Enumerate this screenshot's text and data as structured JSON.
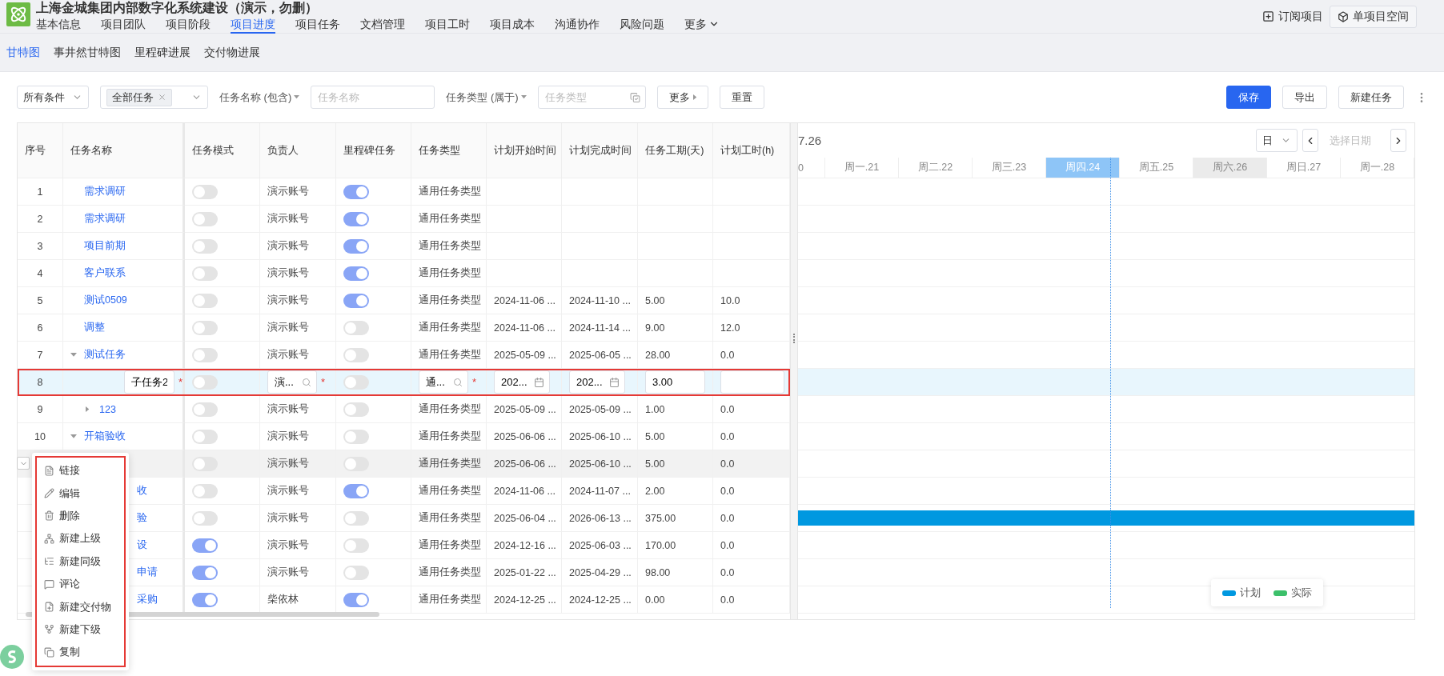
{
  "header": {
    "title": "上海金城集团内部数字化系统建设（演示，勿删）",
    "nav": [
      {
        "label": "基本信息",
        "selected": false
      },
      {
        "label": "项目团队",
        "selected": false
      },
      {
        "label": "项目阶段",
        "selected": false
      },
      {
        "label": "项目进度",
        "selected": true
      },
      {
        "label": "项目任务",
        "selected": false
      },
      {
        "label": "文档管理",
        "selected": false
      },
      {
        "label": "项目工时",
        "selected": false
      },
      {
        "label": "项目成本",
        "selected": false
      },
      {
        "label": "沟通协作",
        "selected": false
      },
      {
        "label": "风险问题",
        "selected": false
      }
    ],
    "more": "更多",
    "subscribe": "订阅项目",
    "space": "单项目空间"
  },
  "subtabs": [
    {
      "label": "甘特图",
      "selected": true
    },
    {
      "label": "事井然甘特图",
      "selected": false
    },
    {
      "label": "里程碑进展",
      "selected": false
    },
    {
      "label": "交付物进展",
      "selected": false
    }
  ],
  "filters": {
    "condition": "所有条件",
    "tag": "全部任务",
    "name_label": "任务名称 (包含)",
    "name_placeholder": "任务名称",
    "type_label": "任务类型 (属于)",
    "type_placeholder": "任务类型",
    "more": "更多",
    "reset": "重置"
  },
  "actions": {
    "save": "保存",
    "export": "导出",
    "new_task": "新建任务"
  },
  "table": {
    "columns": [
      "序号",
      "任务名称",
      "任务模式",
      "负责人",
      "里程碑任务",
      "任务类型",
      "计划开始时间",
      "计划完成时间",
      "任务工期(天)",
      "计划工时(h)"
    ],
    "rows": [
      {
        "kind": "task",
        "no": "1",
        "name": "需求调研",
        "mode": false,
        "milestone": true,
        "owner": "演示账号",
        "type": "通用任务类型"
      },
      {
        "kind": "task",
        "no": "2",
        "name": "需求调研",
        "mode": false,
        "milestone": true,
        "owner": "演示账号",
        "type": "通用任务类型"
      },
      {
        "kind": "task",
        "no": "3",
        "name": "项目前期",
        "mode": false,
        "milestone": true,
        "owner": "演示账号",
        "type": "通用任务类型"
      },
      {
        "kind": "task",
        "no": "4",
        "name": "客户联系",
        "mode": false,
        "milestone": true,
        "owner": "演示账号",
        "type": "通用任务类型"
      },
      {
        "kind": "task",
        "no": "5",
        "name": "测试0509",
        "mode": false,
        "milestone": true,
        "owner": "演示账号",
        "type": "通用任务类型",
        "start": "2024-11-06 ...",
        "end": "2024-11-10 ...",
        "duration": "5.00",
        "hours": "10.0"
      },
      {
        "kind": "task",
        "no": "6",
        "name": "调整",
        "mode": false,
        "milestone": false,
        "owner": "演示账号",
        "type": "通用任务类型",
        "start": "2024-11-06 ...",
        "end": "2024-11-14 ...",
        "duration": "9.00",
        "hours": "12.0"
      },
      {
        "kind": "task",
        "no": "7",
        "name": "测试任务",
        "expanded": true,
        "mode": false,
        "milestone": false,
        "owner": "演示账号",
        "type": "通用任务类型",
        "start": "2025-05-09 ...",
        "end": "2025-06-05 ...",
        "duration": "28.00",
        "hours": "0.0",
        "children": [
          {
            "kind": "edit",
            "no": "8",
            "required_mark": "*",
            "name": "子任务2",
            "mode": false,
            "milestone": false,
            "owner": "演...",
            "type": "通...",
            "start": "202...",
            "end": "202...",
            "duration": "3.00"
          },
          {
            "kind": "task",
            "no": "9",
            "name": "123",
            "expanded": false,
            "mode": false,
            "milestone": false,
            "owner": "演示账号",
            "type": "通用任务类型",
            "start": "2025-05-09 ...",
            "end": "2025-05-09 ...",
            "duration": "1.00",
            "hours": "0.0"
          }
        ]
      },
      {
        "kind": "task",
        "no": "10",
        "name": "开箱验收",
        "expanded": true,
        "mode": false,
        "milestone": false,
        "owner": "演示账号",
        "type": "通用任务类型",
        "start": "2025-06-06 ...",
        "end": "2025-06-10 ...",
        "duration": "5.00",
        "hours": "0.0",
        "children": [
          {
            "kind": "hovered",
            "mode": false,
            "milestone": false,
            "owner": "演示账号",
            "type": "通用任务类型",
            "start": "2025-06-06 ...",
            "end": "2025-06-10 ...",
            "duration": "5.00",
            "hours": "0.0"
          }
        ]
      },
      {
        "kind": "covered",
        "name": "收",
        "mode": false,
        "milestone": true,
        "owner": "演示账号",
        "type": "通用任务类型",
        "start": "2024-11-06 ...",
        "end": "2024-11-07 ...",
        "duration": "2.00",
        "hours": "0.0"
      },
      {
        "kind": "covered",
        "name": "验",
        "mode": false,
        "milestone": false,
        "owner": "演示账号",
        "type": "通用任务类型",
        "start": "2025-06-04 ...",
        "end": "2026-06-13 ...",
        "duration": "375.00",
        "hours": "0.0",
        "plan_bar": true
      },
      {
        "kind": "covered",
        "name": "设",
        "mode": true,
        "milestone": false,
        "owner": "演示账号",
        "type": "通用任务类型",
        "start": "2024-12-16 ...",
        "end": "2025-06-03 ...",
        "duration": "170.00",
        "hours": "0.0"
      },
      {
        "kind": "covered",
        "name": "申请",
        "mode": true,
        "milestone": false,
        "owner": "演示账号",
        "type": "通用任务类型",
        "start": "2025-01-22 ...",
        "end": "2025-04-29 ...",
        "duration": "98.00",
        "hours": "0.0"
      },
      {
        "kind": "covered",
        "name": "采购",
        "mode": true,
        "milestone": true,
        "owner": "柴依林",
        "type": "通用任务类型",
        "start": "2024-12-25 ...",
        "end": "2024-12-25 ...",
        "duration": "0.00",
        "hours": "0.0"
      }
    ]
  },
  "gantt": {
    "date": "7.26",
    "scale": "日",
    "date_placeholder": "选择日期",
    "days": [
      {
        "label": "0",
        "selected": false,
        "shaded": false
      },
      {
        "label": "周一.21",
        "selected": false,
        "shaded": false
      },
      {
        "label": "周二.22",
        "selected": false,
        "shaded": false
      },
      {
        "label": "周三.23",
        "selected": false,
        "shaded": false
      },
      {
        "label": "周四.24",
        "selected": true,
        "shaded": false
      },
      {
        "label": "周五.25",
        "selected": false,
        "shaded": false
      },
      {
        "label": "周六.26",
        "selected": false,
        "shaded": true
      },
      {
        "label": "周日.27",
        "selected": false,
        "shaded": false
      },
      {
        "label": "周一.28",
        "selected": false,
        "shaded": false
      }
    ],
    "legend": [
      {
        "label": "计划",
        "color": "#0098e0"
      },
      {
        "label": "实际",
        "color": "#3cc06a"
      }
    ]
  },
  "context_menu": [
    "链接",
    "编辑",
    "删除",
    "新建上级",
    "新建同级",
    "评论",
    "新建交付物",
    "新建下级",
    "复制"
  ]
}
